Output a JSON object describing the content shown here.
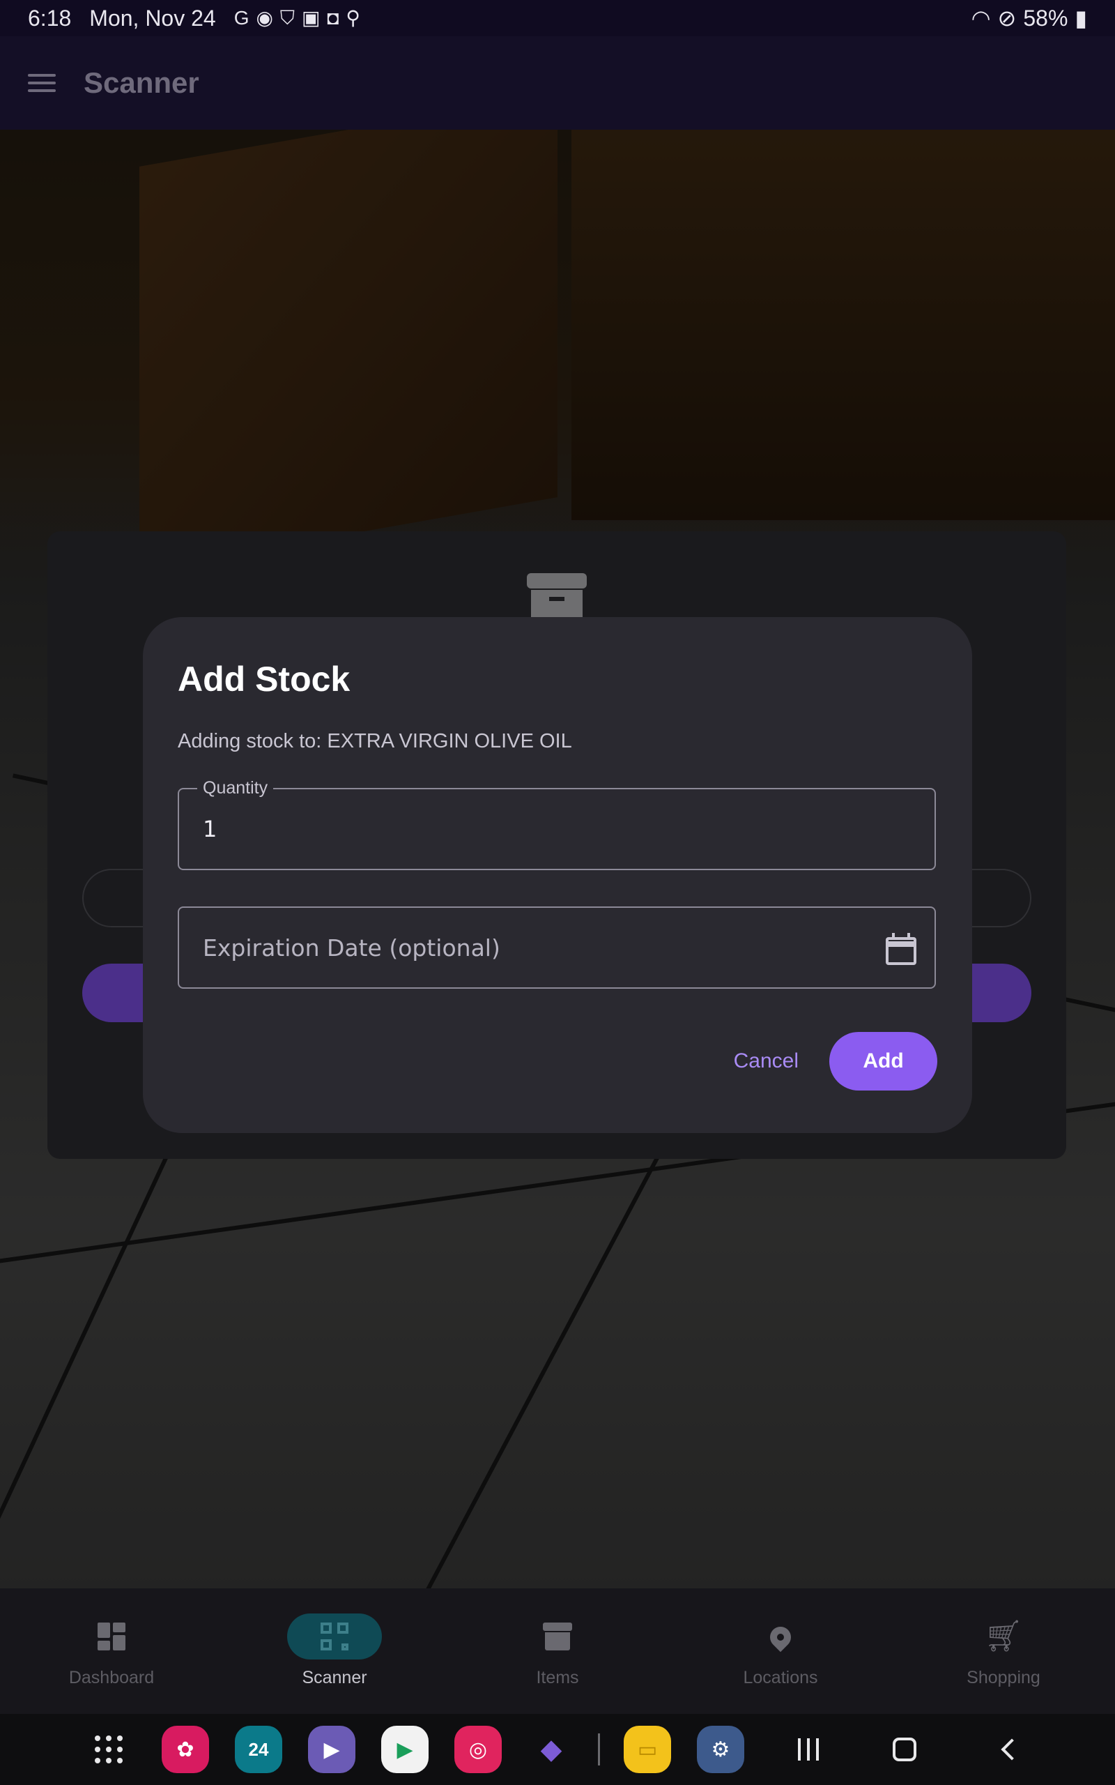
{
  "status_bar": {
    "time": "6:18",
    "date": "Mon, Nov 24",
    "battery": "58%"
  },
  "app_bar": {
    "title": "Scanner"
  },
  "dialog": {
    "title": "Add Stock",
    "subtitle": "Adding stock to: EXTRA VIRGIN OLIVE OIL",
    "quantity_label": "Quantity",
    "quantity_value": "1",
    "expiration_placeholder": "Expiration Date (optional)",
    "cancel_label": "Cancel",
    "add_label": "Add"
  },
  "bottom_nav": {
    "items": [
      {
        "label": "Dashboard",
        "icon": "dashboard-icon"
      },
      {
        "label": "Scanner",
        "icon": "qr-scanner-icon",
        "active": true
      },
      {
        "label": "Items",
        "icon": "archive-icon"
      },
      {
        "label": "Locations",
        "icon": "location-pin-icon"
      },
      {
        "label": "Shopping",
        "icon": "shopping-cart-icon"
      }
    ]
  },
  "taskbar": {
    "calendar_day": "24",
    "apps": [
      "app-drawer-icon",
      "blossom-gallery-icon",
      "calendar-icon",
      "video-player-icon",
      "play-store-icon",
      "camera-icon",
      "crystal-app-icon",
      "files-icon",
      "settings-icon"
    ]
  },
  "colors": {
    "accent": "#8b5cf0",
    "accent_text": "#a98bf5",
    "dialog_bg": "#2a2930",
    "active_nav_pill": "#0f4a55"
  }
}
